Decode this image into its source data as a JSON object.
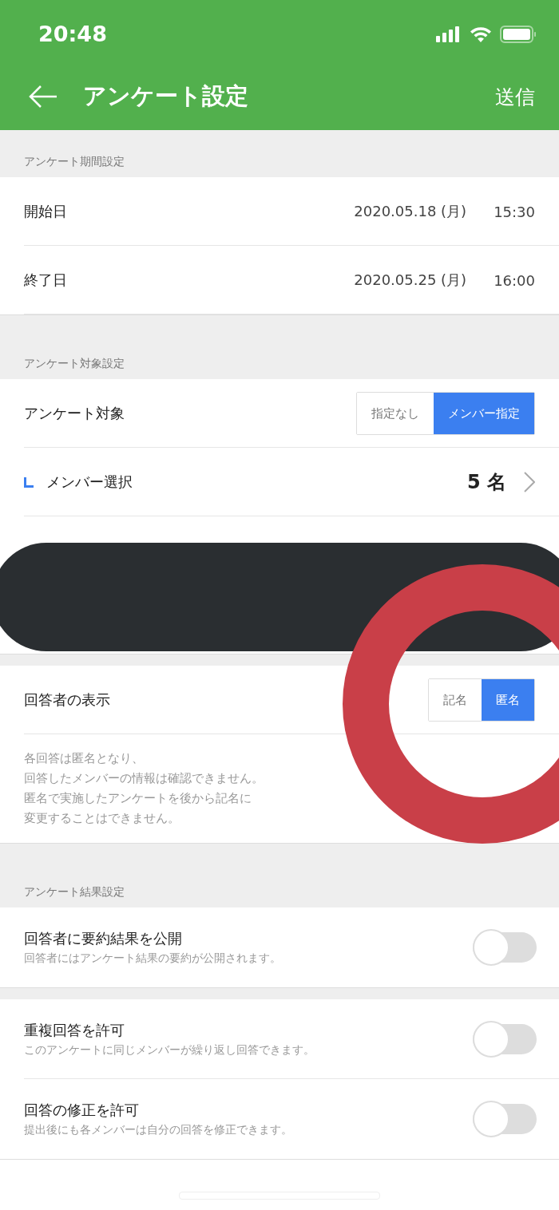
{
  "status_bar": {
    "time": "20:48"
  },
  "nav": {
    "title": "アンケート設定",
    "action": "送信"
  },
  "sections": [
    {
      "header": "アンケート期間設定",
      "rows": [
        {
          "kind": "datetime",
          "label": "開始日",
          "date": "2020.05.18 (月)",
          "time": "15:30"
        },
        {
          "kind": "datetime",
          "label": "終了日",
          "date": "2020.05.25 (月)",
          "time": "16:00"
        }
      ]
    },
    {
      "header": "アンケート対象設定",
      "rows": [
        {
          "kind": "segmented",
          "label": "アンケート対象",
          "options": [
            {
              "label": "指定なし",
              "selected": false
            },
            {
              "label": "メンバー指定",
              "selected": true
            }
          ]
        },
        {
          "kind": "link",
          "label": "メンバー選択",
          "value": "5 名"
        },
        {
          "kind": "redacted"
        }
      ]
    },
    {
      "rows": [
        {
          "kind": "segmented",
          "label": "回答者の表示",
          "options": [
            {
              "label": "記名",
              "selected": false
            },
            {
              "label": "匿名",
              "selected": true
            }
          ]
        },
        {
          "kind": "note",
          "lines": [
            "各回答は匿名となり、",
            "回答したメンバーの情報は確認できません。",
            "匿名で実施したアンケートを後から記名に",
            "変更することはできません。"
          ]
        }
      ]
    },
    {
      "header": "アンケート結果設定",
      "rows": [
        {
          "kind": "toggle",
          "label": "回答者に要約結果を公開",
          "sub": "回答者にはアンケート結果の要約が公開されます。",
          "on": false
        }
      ]
    },
    {
      "rows": [
        {
          "kind": "toggle",
          "label": "重複回答を許可",
          "sub": "このアンケートに同じメンバーが繰り返し回答できます。",
          "on": false
        },
        {
          "kind": "toggle",
          "label": "回答の修正を許可",
          "sub": "提出後にも各メンバーは自分の回答を修正できます。",
          "on": false
        }
      ]
    }
  ],
  "annotations": [
    {
      "kind": "redaction"
    },
    {
      "kind": "ring"
    }
  ]
}
